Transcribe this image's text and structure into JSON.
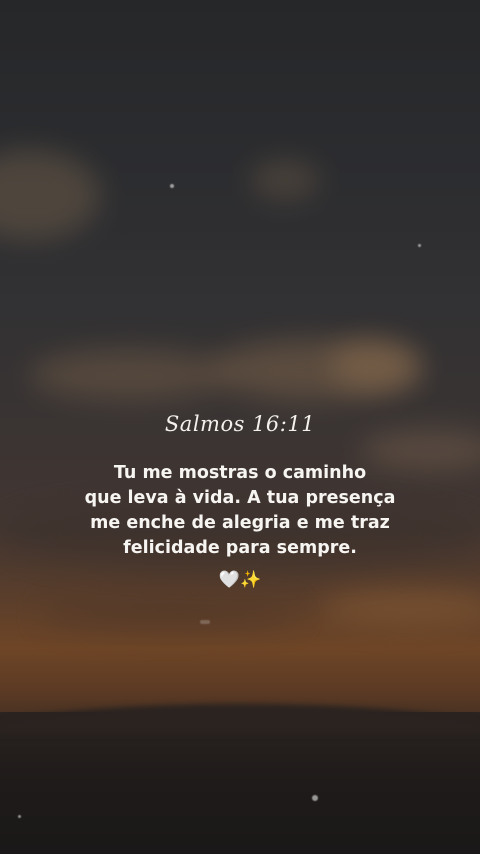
{
  "reference": "Salmos 16:11",
  "verse_lines": [
    "Tu me mostras o caminho",
    "que leva à vida. A tua presença",
    "me enche de alegria e me traz",
    "felicidade para sempre."
  ],
  "emojis": {
    "heart": "🤍",
    "sparkles": "✨"
  },
  "icons": [
    "white-heart-icon",
    "sparkles-icon"
  ],
  "colors": {
    "text": "#f7f5f2",
    "sky_top": "#262729",
    "horizon_glow": "#6e4526",
    "ground": "#1e1c1b"
  }
}
